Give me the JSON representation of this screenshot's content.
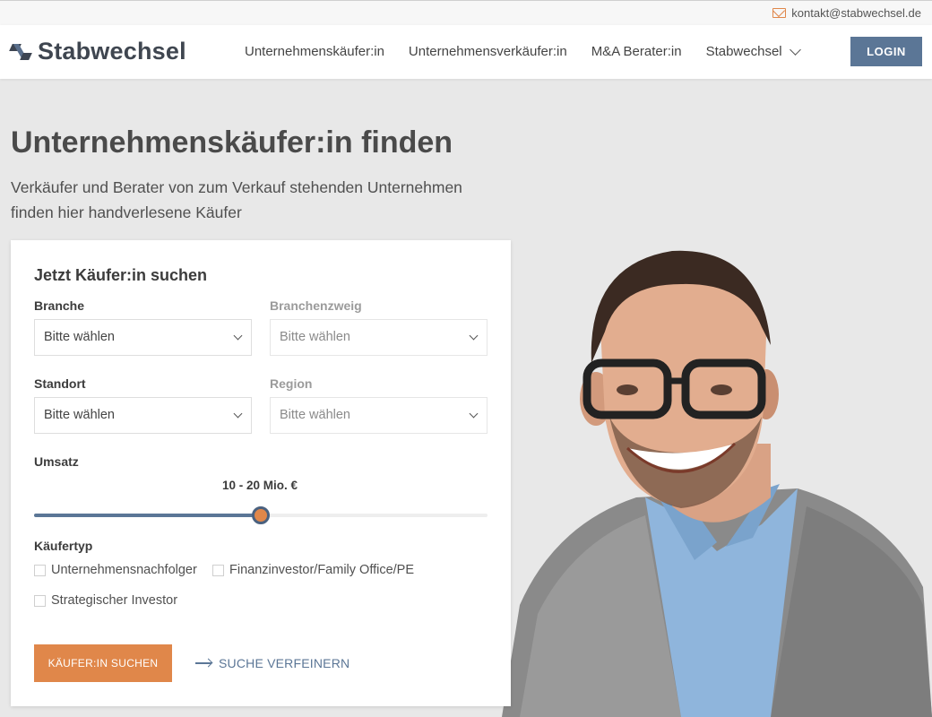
{
  "topbar": {
    "email": "kontakt@stabwechsel.de",
    "icon": "mail-icon"
  },
  "header": {
    "brand": "Stabwechsel",
    "nav": [
      {
        "label": "Unternehmenskäufer:in"
      },
      {
        "label": "Unternehmensverkäufer:in"
      },
      {
        "label": "M&A Berater:in"
      },
      {
        "label": "Stabwechsel"
      }
    ],
    "login": "LOGIN"
  },
  "hero": {
    "title_bold": "Unternehmenskäufer:in",
    "title_rest": " finden",
    "subtitle_line1": "Verkäufer und Berater von zum Verkauf stehenden Unternehmen",
    "subtitle_line2": "finden hier handverlesene Käufer"
  },
  "form": {
    "heading": "Jetzt Käufer:in suchen",
    "branche": {
      "label": "Branche",
      "value": "Bitte wählen"
    },
    "branchenzweig": {
      "label": "Branchenzweig",
      "value": "Bitte wählen"
    },
    "standort": {
      "label": "Standort",
      "value": "Bitte wählen"
    },
    "region": {
      "label": "Region",
      "value": "Bitte wählen"
    },
    "umsatz": {
      "label": "Umsatz",
      "value_text": "10 - 20 Mio. €",
      "fraction": 0.5
    },
    "kaeufertyp": {
      "label": "Käufertyp",
      "options": [
        {
          "label": "Unternehmensnachfolger",
          "checked": false
        },
        {
          "label": "Finanzinvestor/Family Office/PE",
          "checked": false
        },
        {
          "label": "Strategischer Investor",
          "checked": false
        }
      ]
    },
    "submit": "KÄUFER:IN SUCHEN",
    "refine": "SUCHE VERFEINERN"
  },
  "colors": {
    "accent": "#e0874a",
    "primary": "#5b7696"
  }
}
